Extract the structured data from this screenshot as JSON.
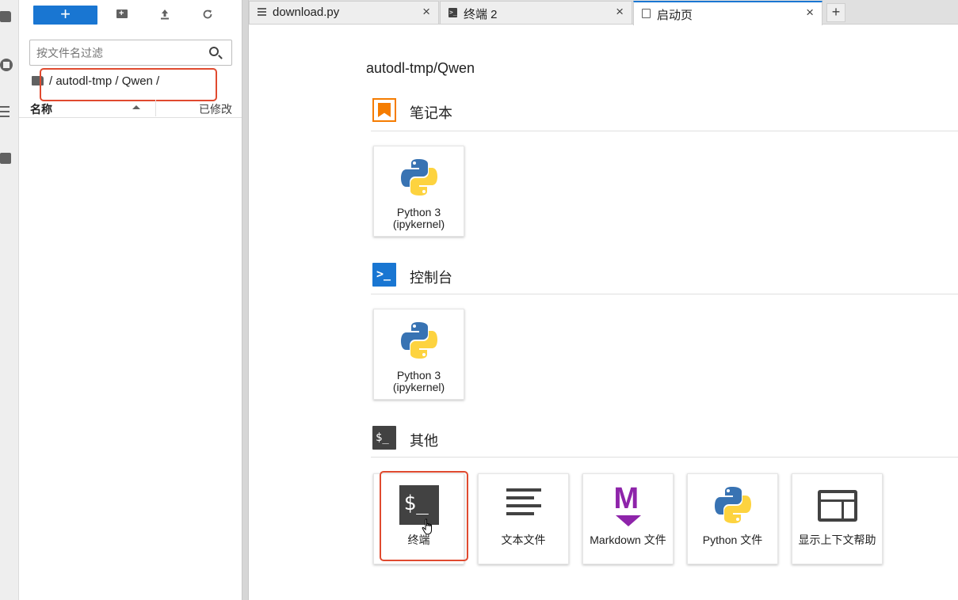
{
  "activity_bar": {
    "icons": [
      "folder-icon",
      "running-icon",
      "commands-icon",
      "extensions-icon"
    ]
  },
  "file_browser": {
    "new_label": "+",
    "toolbar_icons": [
      "new-folder-icon",
      "upload-icon",
      "refresh-icon"
    ],
    "filter_placeholder": "按文件名过滤",
    "breadcrumb": "/ autodl-tmp / Qwen /",
    "columns": {
      "name": "名称",
      "modified": "已修改"
    }
  },
  "tabs": [
    {
      "label": "download.py",
      "close": "×"
    },
    {
      "label": "终端 2",
      "close": "×"
    },
    {
      "label": "启动页",
      "close": "×"
    }
  ],
  "add_tab": "+",
  "launcher": {
    "cwd": "autodl-tmp/Qwen",
    "sections": [
      {
        "title": "笔记本",
        "cards": [
          {
            "line1": "Python 3",
            "line2": "(ipykernel)"
          }
        ]
      },
      {
        "title": "控制台",
        "cards": [
          {
            "line1": "Python 3",
            "line2": "(ipykernel)"
          }
        ]
      },
      {
        "title": "其他",
        "cards": [
          {
            "label": "终端"
          },
          {
            "label": "文本文件"
          },
          {
            "label": "Markdown 文件"
          },
          {
            "label": "Python 文件"
          },
          {
            "label": "显示上下文帮助"
          }
        ]
      }
    ]
  },
  "colors": {
    "accent": "#1976d2",
    "notebook": "#f57c00",
    "markdown": "#8e24aa",
    "highlight": "#e04a2f"
  }
}
